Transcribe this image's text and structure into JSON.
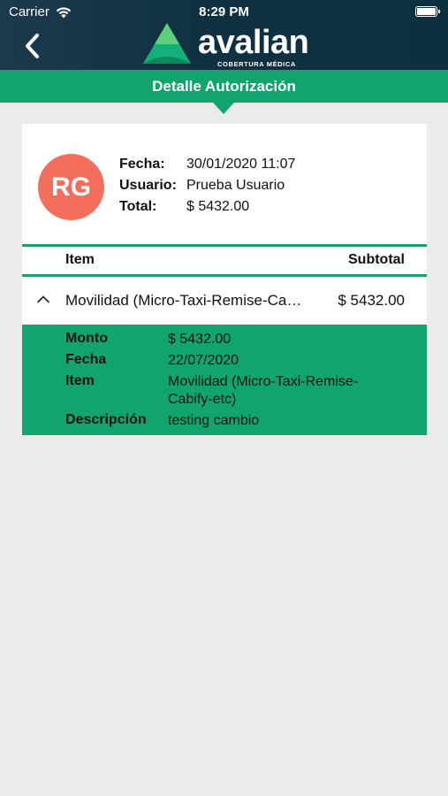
{
  "status_bar": {
    "carrier": "Carrier",
    "time": "8:29 PM"
  },
  "header": {
    "brand": "avalian",
    "brand_sub": "COBERTURA MÉDICA",
    "page_title": "Detalle Autorización",
    "colors": {
      "dark": "#0f3142",
      "green": "#12a46f",
      "avatar": "#f46e5c"
    }
  },
  "summary": {
    "avatar_initials": "RG",
    "fecha_label": "Fecha:",
    "fecha_value": "30/01/2020 11:07",
    "usuario_label": "Usuario:",
    "usuario_value": "Prueba Usuario",
    "total_label": "Total:",
    "total_value": "$ 5432.00"
  },
  "table": {
    "col_item": "Item",
    "col_subtotal": "Subtotal",
    "rows": [
      {
        "name": "Movilidad (Micro-Taxi-Remise-Cabify-etc)",
        "subtotal": "$ 5432.00",
        "expanded": true,
        "detail": {
          "monto_label": "Monto",
          "monto_value": "$ 5432.00",
          "fecha_label": "Fecha",
          "fecha_value": "22/07/2020",
          "item_label": "Item",
          "item_value": "Movilidad (Micro-Taxi-Remise-Cabify-etc)",
          "descripcion_label": "Descripción",
          "descripcion_value": "testing cambio"
        }
      }
    ]
  },
  "icons": [
    "wifi-icon",
    "battery-icon",
    "back-chevron-icon",
    "avalian-logo-icon",
    "chevron-up-icon"
  ]
}
